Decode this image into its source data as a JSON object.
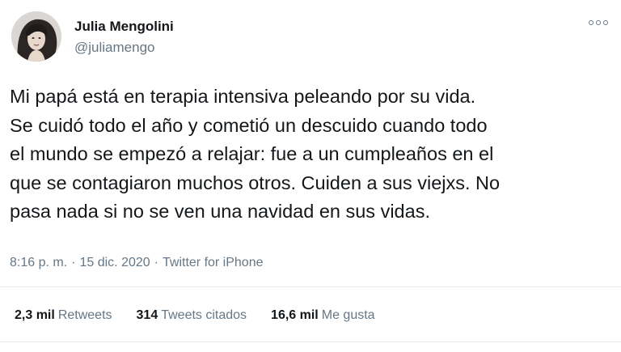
{
  "tweet": {
    "author": {
      "display_name": "Julia Mengolini",
      "handle": "@juliamengo"
    },
    "more_icon": "more-options-icon",
    "text_lines": [
      "Mi papá está en terapia intensiva peleando por su vida.",
      "Se cuidó todo el año y cometió un descuido cuando todo",
      "el mundo se empezó a relajar: fue a un cumpleaños en el",
      "que se contagiaron muchos otros. Cuiden a sus viejxs. No",
      "pasa nada si no se ven una navidad en sus vidas."
    ],
    "meta": {
      "time": "8:16 p. m.",
      "date": "15 dic. 2020",
      "separator": "·",
      "source": "Twitter for iPhone"
    },
    "stats": {
      "retweets": {
        "count": "2,3 mil",
        "label": "Retweets"
      },
      "quotes": {
        "count": "314",
        "label": "Tweets citados"
      },
      "likes": {
        "count": "16,6 mil",
        "label": "Me gusta"
      }
    },
    "colors": {
      "text": "#14171a",
      "secondary": "#657786",
      "divider": "#e6ecf0"
    }
  }
}
